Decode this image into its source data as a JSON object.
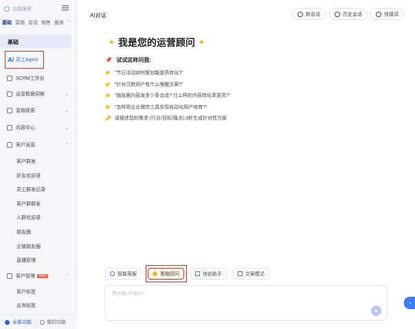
{
  "sidebar": {
    "search_placeholder": "功能搜索",
    "tabs": [
      "基础",
      "营销",
      "会话",
      "销售",
      "服务"
    ],
    "active_section": "基础",
    "agent": {
      "badge": "Ai",
      "label": "员工Agent"
    },
    "nav": [
      {
        "label": "SCRM工作台",
        "chevron": ""
      },
      {
        "label": "运营数据洞察",
        "chevron": "⌄"
      },
      {
        "label": "营销获客",
        "chevron": "⌄"
      },
      {
        "label": "内容中心",
        "chevron": "⌄"
      },
      {
        "label": "客户运营",
        "chevron": "⌃"
      }
    ],
    "customer_ops_items": [
      "客户群发",
      "好友欢迎语",
      "员工群发记录",
      "客户群群发",
      "入群欢迎语",
      "朋友圈",
      "企微朋友圈",
      "直播管理"
    ],
    "customer_mgmt": {
      "label": "客户管理",
      "badge": "NEW",
      "chevron": "⌃"
    },
    "customer_mgmt_items": [
      "客户标签",
      "业务标签"
    ],
    "bottom": {
      "all_label": "全部功能",
      "mine_label": "我的功能"
    }
  },
  "header": {
    "title": "AI对话",
    "buttons": [
      "新会话",
      "历史会话",
      "快捷词"
    ]
  },
  "hero": {
    "title": "我是您的运营顾问"
  },
  "try_section": {
    "title": "试试这样问我:",
    "prompts": [
      "\"节日活动如何策划能提高转化?\"",
      "\"针对沉默用户有什么唤醒方案?\"",
      "\"朋友圈内容发多少条合适? 什么样的内容转化率更高?\"",
      "\"怎样用企业微信工具实现自动化用户培育?\""
    ],
    "hint": "请描述您的需求 (行业/目标/痛点),3秒生成针对性方案"
  },
  "modes": [
    {
      "label": "智能客服"
    },
    {
      "label": "策略顾问",
      "selected": true
    },
    {
      "label": "快创助手"
    },
    {
      "label": "文案模式"
    }
  ],
  "input": {
    "placeholder": "有问题,尽管问~",
    "send_icon": "send-icon"
  },
  "colors": {
    "accent": "#2f5ed8",
    "highlight": "#d42a2a",
    "sidebar_bg": "#f4f6fa"
  }
}
